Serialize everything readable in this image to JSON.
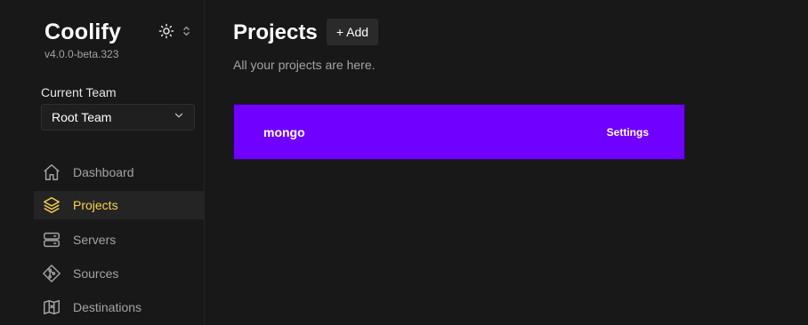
{
  "brand": {
    "title": "Coolify",
    "version": "v4.0.0-beta.323"
  },
  "theme_toggle": {
    "icon": "sun-icon",
    "chevron": "chevron-updown-icon"
  },
  "team": {
    "label": "Current Team",
    "selected": "Root Team"
  },
  "nav": {
    "items": [
      {
        "label": "Dashboard",
        "icon": "home-icon",
        "active": false
      },
      {
        "label": "Projects",
        "icon": "layers-icon",
        "active": true
      },
      {
        "label": "Servers",
        "icon": "server-icon",
        "active": false
      },
      {
        "label": "Sources",
        "icon": "git-branch-icon",
        "active": false
      },
      {
        "label": "Destinations",
        "icon": "map-icon",
        "active": false
      }
    ]
  },
  "main": {
    "title": "Projects",
    "add_label": "+ Add",
    "subtitle": "All your projects are here."
  },
  "projects": [
    {
      "name": "mongo",
      "settings_label": "Settings"
    }
  ],
  "colors": {
    "background": "#181818",
    "accent": "#fcd34d",
    "project_card": "#7000ff"
  }
}
